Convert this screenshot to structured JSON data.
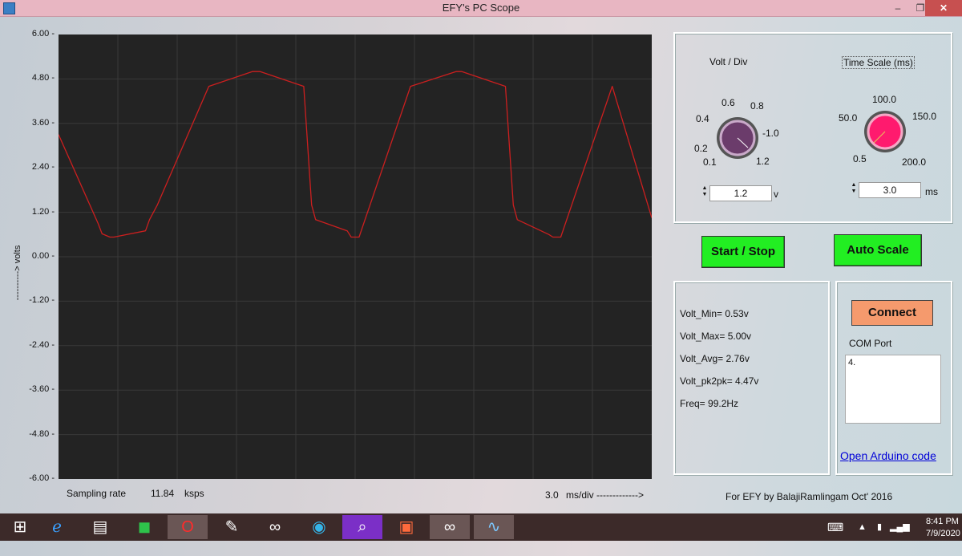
{
  "window": {
    "title": "EFY's PC Scope",
    "minimize": "–",
    "restore": "❐",
    "close": "✕"
  },
  "plot": {
    "y_ticks": [
      "6.00",
      "4.80",
      "3.60",
      "2.40",
      "1.20",
      "0.00",
      "-1.20",
      "-2.40",
      "-3.60",
      "-4.80",
      "-6.00"
    ],
    "y_axis_title": "----------> volts",
    "colors": {
      "background": "#232323",
      "grid": "#3a3a3a",
      "trace": "#cc1f1f"
    }
  },
  "chart_data": {
    "type": "line",
    "title": "",
    "xlabel": "3.0  ms/div ------------->",
    "ylabel": "----------> volts",
    "ylim": [
      -6.0,
      6.0
    ],
    "xlim": [
      0,
      30
    ],
    "grid": true,
    "series": [
      {
        "x": [
          0.0,
          2.0,
          2.2,
          2.6,
          2.8,
          4.4,
          4.6,
          5.0,
          7.6,
          9.8,
          10.2,
          12.4,
          12.8,
          13.0,
          14.6,
          14.8,
          15.2,
          17.8,
          20.1,
          20.4,
          22.6,
          23.0,
          23.2,
          24.8,
          25.0,
          25.4,
          28.0,
          30.0
        ],
        "y": [
          3.3,
          0.9,
          0.62,
          0.53,
          0.53,
          0.7,
          1.0,
          1.4,
          4.6,
          5.0,
          5.0,
          4.6,
          1.4,
          1.0,
          0.7,
          0.53,
          0.53,
          4.6,
          5.0,
          5.0,
          4.6,
          1.4,
          1.0,
          0.6,
          0.53,
          0.53,
          4.6,
          1.05
        ]
      }
    ]
  },
  "footer": {
    "sampling_label": "Sampling rate",
    "sampling_value": "11.84",
    "sampling_unit": "ksps",
    "ms_div_value": "3.0",
    "ms_div_label": "ms/div ------------->",
    "credit": "For EFY by BalajiRamlingam Oct' 2016"
  },
  "volt_div": {
    "title": "Volt / Div",
    "labels": [
      "0.6",
      "0.8",
      "0.4",
      "-1.0",
      "0.2",
      "0.1",
      "1.2"
    ],
    "value": "1.2",
    "unit": "v",
    "knob_color": "#6b3c6b"
  },
  "time_scale": {
    "title": "Time Scale (ms)",
    "labels": [
      "100.0",
      "50.0",
      "150.0",
      "0.5",
      "200.0"
    ],
    "value": "3.0",
    "unit": "ms",
    "knob_color": "#ff1a6e"
  },
  "buttons": {
    "start_stop": "Start / Stop",
    "auto_scale": "Auto Scale",
    "connect": "Connect"
  },
  "stats": {
    "min": "Volt_Min= 0.53v",
    "max": "Volt_Max= 5.00v",
    "avg": "Volt_Avg= 2.76v",
    "pk2pk": "Volt_pk2pk= 4.47v",
    "freq": "Freq= 99.2Hz"
  },
  "com": {
    "label": "COM Port",
    "value": "4.",
    "link": "Open Arduino code"
  },
  "taskbar": {
    "time": "8:41 PM",
    "date": "7/9/2020",
    "tray_up": "▲"
  }
}
